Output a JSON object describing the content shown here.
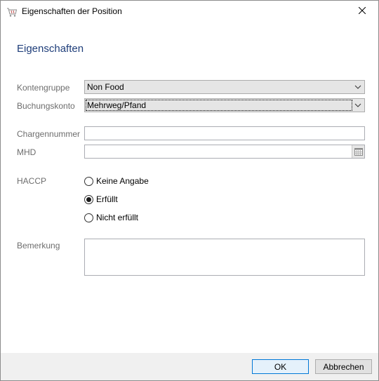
{
  "window": {
    "title": "Eigenschaften der Position"
  },
  "section": {
    "heading": "Eigenschaften"
  },
  "fields": {
    "kontengruppe": {
      "label": "Kontengruppe",
      "value": "Non Food"
    },
    "buchungskonto": {
      "label": "Buchungskonto",
      "value": "Mehrweg/Pfand"
    },
    "chargennummer": {
      "label": "Chargennummer",
      "value": ""
    },
    "mhd": {
      "label": "MHD",
      "value": ""
    },
    "haccp": {
      "label": "HACCP",
      "options": [
        "Keine Angabe",
        "Erfüllt",
        "Nicht erfüllt"
      ],
      "selected": "Erfüllt"
    },
    "bemerkung": {
      "label": "Bemerkung",
      "value": ""
    }
  },
  "buttons": {
    "ok": "OK",
    "cancel": "Abbrechen"
  },
  "icons": {
    "app": "shopping-cart-icon",
    "close": "close-icon",
    "dropdown": "chevron-down-icon",
    "calendar": "calendar-icon"
  }
}
